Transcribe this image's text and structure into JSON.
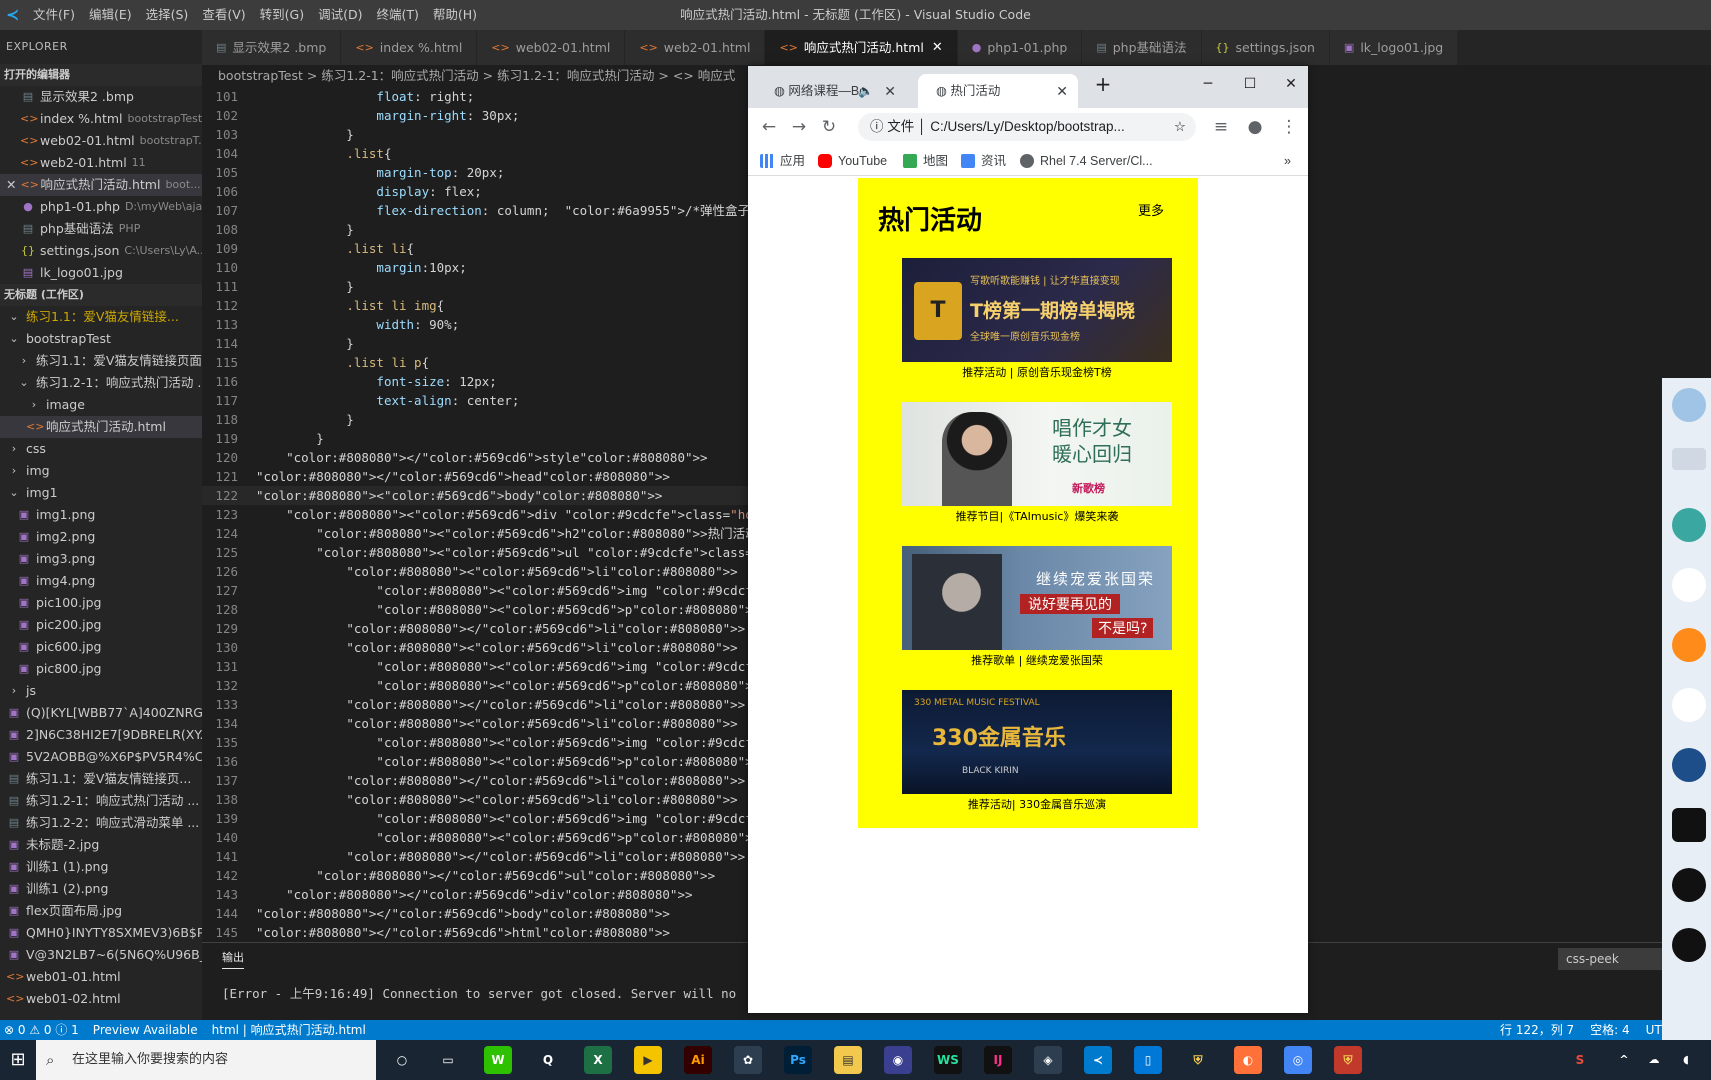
{
  "titlebar": {
    "menu": [
      "文件(F)",
      "编辑(E)",
      "选择(S)",
      "查看(V)",
      "转到(G)",
      "调试(D)",
      "终端(T)",
      "帮助(H)"
    ],
    "title": "响应式热门活动.html - 无标题 (工作区) - Visual Studio Code"
  },
  "explorer": {
    "header": "EXPLORER",
    "open_editors_label": "打开的编辑器",
    "open_editors": [
      {
        "name": "显示效果2 .bmp",
        "desc": ""
      },
      {
        "name": "index %.html",
        "desc": "bootstrapTest..."
      },
      {
        "name": "web02-01.html",
        "desc": "bootstrapT..."
      },
      {
        "name": "web2-01.html",
        "desc": "11"
      },
      {
        "name": "响应式热门活动.html",
        "desc": "boot..."
      },
      {
        "name": "php1-01.php",
        "desc": "D:\\myWeb\\ajax"
      },
      {
        "name": "php基础语法",
        "desc": "PHP"
      },
      {
        "name": "settings.json",
        "desc": "C:\\Users\\Ly\\A..."
      },
      {
        "name": "lk_logo01.jpg",
        "desc": ""
      }
    ],
    "workspace_label": "无标题 (工作区)",
    "tree": [
      "练习1.1：爱V猫友情链接...",
      "bootstrapTest",
      "练习1.1：爱V猫友情链接页面",
      "练习1.2-1：响应式热门活动 ...",
      "image",
      "响应式热门活动.html",
      "css",
      "img",
      "img1",
      "img1.png",
      "img2.png",
      "img3.png",
      "img4.png",
      "pic100.jpg",
      "pic200.jpg",
      "pic600.jpg",
      "pic800.jpg",
      "js",
      "(Q)[KYL[WBB77`A]400ZNRG....",
      "2]N6C38HI2E7[9DBRELR(XY....",
      "5V2AOBB@%X6P$PV5R4%C...",
      "练习1.1：爱V猫友情链接页...",
      "练习1.2-1：响应式热门活动 ...",
      "练习1.2-2：响应式滑动菜单 ...",
      "未标题-2.jpg",
      "训练1 (1).png",
      "训练1 (2).png",
      "flex页面布局.jpg",
      "QMH0}INYTY8SXMEV3)6B$P...",
      "V@3N2LB7~6(5N6Q%U96B_...",
      "web01-01.html",
      "web01-02.html"
    ]
  },
  "tabs": [
    "显示效果2 .bmp",
    "index %.html",
    "web02-01.html",
    "web2-01.html",
    "响应式热门活动.html",
    "php1-01.php",
    "php基础语法",
    "settings.json",
    "lk_logo01.jpg"
  ],
  "breadcrumb": "bootstrapTest > 练习1.2-1：响应式热门活动 > 练习1.2-1：响应式热门活动 > <> 响应式",
  "editor": {
    "lines": [
      {
        "n": "101",
        "t": "                float: right;"
      },
      {
        "n": "102",
        "t": "                margin-right: 30px;"
      },
      {
        "n": "103",
        "t": "            }"
      },
      {
        "n": "104",
        "t": "            .list{"
      },
      {
        "n": "105",
        "t": "                margin-top: 20px;"
      },
      {
        "n": "106",
        "t": "                display: flex;"
      },
      {
        "n": "107",
        "t": "                flex-direction: column;  /*弹性盒子*/"
      },
      {
        "n": "108",
        "t": "            }"
      },
      {
        "n": "109",
        "t": "            .list li{"
      },
      {
        "n": "110",
        "t": "                margin:10px;"
      },
      {
        "n": "111",
        "t": "            }"
      },
      {
        "n": "112",
        "t": "            .list li img{"
      },
      {
        "n": "113",
        "t": "                width: 90%;"
      },
      {
        "n": "114",
        "t": "            }"
      },
      {
        "n": "115",
        "t": "            .list li p{"
      },
      {
        "n": "116",
        "t": "                font-size: 12px;"
      },
      {
        "n": "117",
        "t": "                text-align: center;"
      },
      {
        "n": "118",
        "t": "            }"
      },
      {
        "n": "119",
        "t": "        }"
      },
      {
        "n": "120",
        "t": "    </style>"
      },
      {
        "n": "121",
        "t": "</head>"
      },
      {
        "n": "122",
        "t": "<body>"
      },
      {
        "n": "123",
        "t": "    <div class=\"hot\">"
      },
      {
        "n": "124",
        "t": "        <h2>热门活动<strong>更多</strong></h2>"
      },
      {
        "n": "125",
        "t": "        <ul class=\"list\">"
      },
      {
        "n": "126",
        "t": "            <li>"
      },
      {
        "n": "127",
        "t": "                <img src=\"image/img1.png\" alt=\"\"/>"
      },
      {
        "n": "128",
        "t": "                <p>推荐活动 | 原创音乐现金榜T榜</p>"
      },
      {
        "n": "129",
        "t": "            </li>"
      },
      {
        "n": "130",
        "t": "            <li>"
      },
      {
        "n": "131",
        "t": "                <img src=\"image/img2.png\" alt=\"\"/>"
      },
      {
        "n": "132",
        "t": "                <p>推荐节目|《TAImusic》爆笑来袭</p>"
      },
      {
        "n": "133",
        "t": "            </li>"
      },
      {
        "n": "134",
        "t": "            <li>"
      },
      {
        "n": "135",
        "t": "                <img src=\"image/img3.png\" alt=\"\"/>"
      },
      {
        "n": "136",
        "t": "                <p>推荐歌单 | 继续宠爱张国荣</p>"
      },
      {
        "n": "137",
        "t": "            </li>"
      },
      {
        "n": "138",
        "t": "            <li>"
      },
      {
        "n": "139",
        "t": "                <img src=\"image/img4.png\" alt=\"\"/>"
      },
      {
        "n": "140",
        "t": "                <p>推荐活动| 330金属音乐巡演 </p>"
      },
      {
        "n": "141",
        "t": "            </li>"
      },
      {
        "n": "142",
        "t": "        </ul>"
      },
      {
        "n": "143",
        "t": "    </div>"
      },
      {
        "n": "144",
        "t": "</body>"
      },
      {
        "n": "145",
        "t": "</html>"
      }
    ]
  },
  "panel": {
    "title": "输出",
    "text": "[Error - 上午9:16:49] Connection to server got closed. Server will no",
    "dropdown": "css-peek"
  },
  "status": {
    "problems": "⊗ 0 ⚠ 0 ⓘ 1",
    "preview": "Preview Available",
    "lang": "html | 响应式热门活动.html",
    "cursor": "行 122，列 7",
    "spaces": "空格: 4",
    "encoding": "UTI"
  },
  "taskbar": {
    "search_placeholder": "在这里输入你要搜索的内容"
  },
  "browser": {
    "tab1": "网络课程—Bo",
    "tab2": "热门活动",
    "url_label": "文件",
    "url": "C:/Users/Ly/Desktop/bootstrap...",
    "bookmarks": [
      "应用",
      "YouTube",
      "地图",
      "资讯",
      "Rhel 7.4 Server/Cl..."
    ],
    "page": {
      "title": "热门活动",
      "more": "更多",
      "items": [
        {
          "caption": "推荐活动 | 原创音乐现金榜T榜",
          "banner1": "T榜第一期榜单揭晓",
          "banner2": "写歌听歌能赚钱 | 让才华直接变现",
          "banner3": "全球唯一原创音乐现金榜"
        },
        {
          "caption": "推荐节目|《TAImusic》爆笑来袭",
          "banner1": "唱作才女",
          "banner2": "暖心回归",
          "banner3": "新歌榜"
        },
        {
          "caption": "推荐歌单 | 继续宠爱张国荣",
          "banner1": "继续宠爱张国荣",
          "banner2": "说好要再见的",
          "banner3": "不是吗?"
        },
        {
          "caption": "推荐活动| 330金属音乐巡演",
          "banner1": "330金属音乐",
          "banner2": "330 METAL MUSIC FESTIVAL",
          "banner3": "BLACK KIRIN"
        }
      ]
    }
  }
}
